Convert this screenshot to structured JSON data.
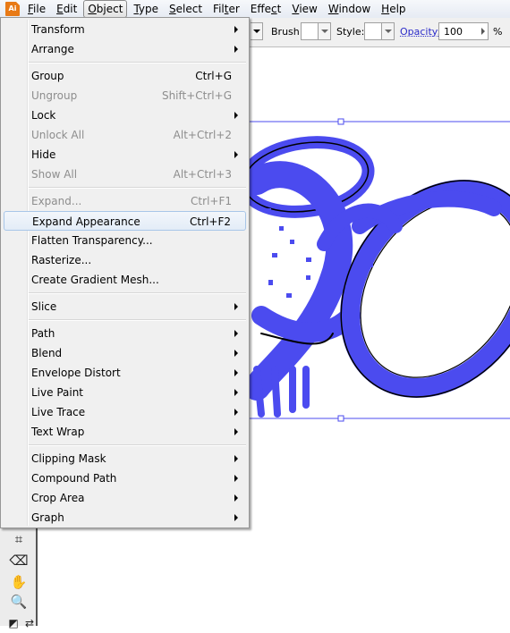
{
  "menubar": {
    "app_icon": "Ai",
    "items": [
      {
        "label": "File",
        "ul": "F",
        "rest": "ile"
      },
      {
        "label": "Edit",
        "ul": "E",
        "rest": "dit"
      },
      {
        "label": "Object",
        "ul": "O",
        "rest": "bject",
        "open": true
      },
      {
        "label": "Type",
        "ul": "T",
        "rest": "ype"
      },
      {
        "label": "Select",
        "ul": "S",
        "rest": "elect"
      },
      {
        "label": "Filter",
        "pre": "Fil",
        "ul": "t",
        "rest": "er"
      },
      {
        "label": "Effect",
        "pre": "Effe",
        "ul": "c",
        "rest": "t"
      },
      {
        "label": "View",
        "ul": "V",
        "rest": "iew"
      },
      {
        "label": "Window",
        "ul": "W",
        "rest": "indow"
      },
      {
        "label": "Help",
        "ul": "H",
        "rest": "elp"
      }
    ]
  },
  "controlbar": {
    "brush_label": "Brush:",
    "style_label": "Style:",
    "opacity_label": "Opacity:",
    "opacity_value": "100",
    "opacity_unit": "%"
  },
  "object_menu": {
    "items": [
      {
        "type": "item",
        "label": "Transform",
        "submenu": true
      },
      {
        "type": "item",
        "label": "Arrange",
        "submenu": true
      },
      {
        "type": "sep"
      },
      {
        "type": "item",
        "label": "Group",
        "shortcut": "Ctrl+G"
      },
      {
        "type": "item",
        "label": "Ungroup",
        "shortcut": "Shift+Ctrl+G",
        "disabled": true
      },
      {
        "type": "item",
        "label": "Lock",
        "submenu": true
      },
      {
        "type": "item",
        "label": "Unlock All",
        "shortcut": "Alt+Ctrl+2",
        "disabled": true
      },
      {
        "type": "item",
        "label": "Hide",
        "submenu": true
      },
      {
        "type": "item",
        "label": "Show All",
        "shortcut": "Alt+Ctrl+3",
        "disabled": true
      },
      {
        "type": "sep"
      },
      {
        "type": "item",
        "label": "Expand...",
        "shortcut": "Ctrl+F1",
        "disabled": true
      },
      {
        "type": "item",
        "label": "Expand Appearance",
        "shortcut": "Ctrl+F2",
        "highlighted": true
      },
      {
        "type": "item",
        "label": "Flatten Transparency..."
      },
      {
        "type": "item",
        "label": "Rasterize..."
      },
      {
        "type": "item",
        "label": "Create Gradient Mesh..."
      },
      {
        "type": "sep"
      },
      {
        "type": "item",
        "label": "Slice",
        "submenu": true
      },
      {
        "type": "sep"
      },
      {
        "type": "item",
        "label": "Path",
        "submenu": true
      },
      {
        "type": "item",
        "label": "Blend",
        "submenu": true
      },
      {
        "type": "item",
        "label": "Envelope Distort",
        "submenu": true
      },
      {
        "type": "item",
        "label": "Live Paint",
        "submenu": true
      },
      {
        "type": "item",
        "label": "Live Trace",
        "submenu": true
      },
      {
        "type": "item",
        "label": "Text Wrap",
        "submenu": true
      },
      {
        "type": "sep"
      },
      {
        "type": "item",
        "label": "Clipping Mask",
        "submenu": true
      },
      {
        "type": "item",
        "label": "Compound Path",
        "submenu": true
      },
      {
        "type": "item",
        "label": "Crop Area",
        "submenu": true
      },
      {
        "type": "item",
        "label": "Graph",
        "submenu": true
      }
    ]
  },
  "tools": [
    {
      "name": "slice-select-tool-icon",
      "glyph": "⌗"
    },
    {
      "name": "eraser-tool-icon",
      "glyph": "⌫"
    },
    {
      "name": "hand-tool-icon",
      "glyph": "✋"
    },
    {
      "name": "zoom-tool-icon",
      "glyph": "🔍"
    },
    {
      "name": "default-colors-icon",
      "glyph": "◩"
    },
    {
      "name": "swap-colors-icon",
      "glyph": "⇄"
    }
  ],
  "colors": {
    "selection": "#4b4bef",
    "highlight_border": "#a8c6e8",
    "disabled_text": "#8d8d8d"
  }
}
